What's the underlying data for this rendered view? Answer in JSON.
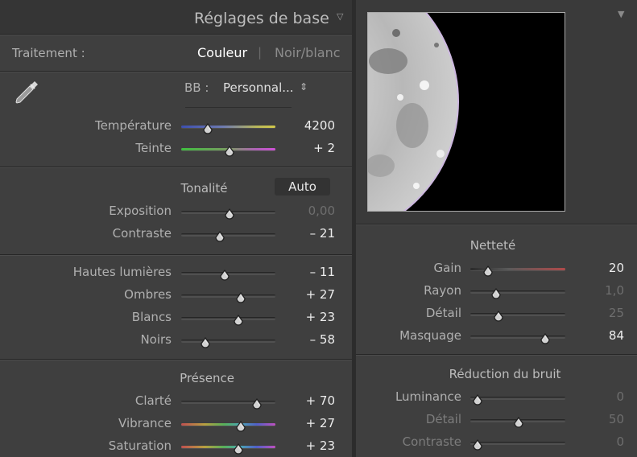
{
  "basic": {
    "title": "Réglages de base",
    "treatment_label": "Traitement :",
    "color_label": "Couleur",
    "separator": "|",
    "bw_label": "Noir/blanc",
    "wb_label": "BB :",
    "wb_value": "Personnal...",
    "wb_arrows": "⇕",
    "tone_label": "Tonalité",
    "auto_label": "Auto",
    "presence_label": "Présence",
    "sliders": [
      {
        "label": "Température",
        "value": "4200",
        "pos": 0.28,
        "type": "temp"
      },
      {
        "label": "Teinte",
        "value": "+ 2",
        "pos": 0.51,
        "type": "tint"
      },
      {
        "label": "Exposition",
        "value": "0,00",
        "pos": 0.51,
        "type": "plain",
        "dim_value": true
      },
      {
        "label": "Contraste",
        "value": "– 21",
        "pos": 0.41,
        "type": "plain"
      },
      {
        "label": "Hautes lumières",
        "value": "– 11",
        "pos": 0.46,
        "type": "plain"
      },
      {
        "label": "Ombres",
        "value": "+ 27",
        "pos": 0.63,
        "type": "plain"
      },
      {
        "label": "Blancs",
        "value": "+ 23",
        "pos": 0.61,
        "type": "plain"
      },
      {
        "label": "Noirs",
        "value": "– 58",
        "pos": 0.26,
        "type": "plain"
      },
      {
        "label": "Clarté",
        "value": "+ 70",
        "pos": 0.8,
        "type": "plain"
      },
      {
        "label": "Vibrance",
        "value": "+ 27",
        "pos": 0.63,
        "type": "vib"
      },
      {
        "label": "Saturation",
        "value": "+ 23",
        "pos": 0.61,
        "type": "sat"
      }
    ]
  },
  "detail": {
    "sharpening_label": "Netteté",
    "noise_label": "Réduction du bruit",
    "sliders": [
      {
        "label": "Gain",
        "value": "20",
        "pos": 0.19,
        "type": "gain"
      },
      {
        "label": "Rayon",
        "value": "1,0",
        "pos": 0.27,
        "type": "plain",
        "dim_value": true
      },
      {
        "label": "Détail",
        "value": "25",
        "pos": 0.3,
        "type": "plain",
        "dim_value": true
      },
      {
        "label": "Masquage",
        "value": "84",
        "pos": 0.79,
        "type": "plain"
      },
      {
        "label": "Luminance",
        "value": "0",
        "pos": 0.08,
        "type": "plain",
        "dim_value": true
      },
      {
        "label": "Détail",
        "value": "50",
        "pos": 0.51,
        "type": "plain",
        "dim_value": true,
        "dim_label": true
      },
      {
        "label": "Contraste",
        "value": "0",
        "pos": 0.08,
        "type": "plain",
        "dim_value": true,
        "dim_label": true
      }
    ]
  },
  "colors": {
    "panel_bg": "#3f3f3f",
    "value_text": "#ededed",
    "label_text": "#b0b0b0"
  }
}
